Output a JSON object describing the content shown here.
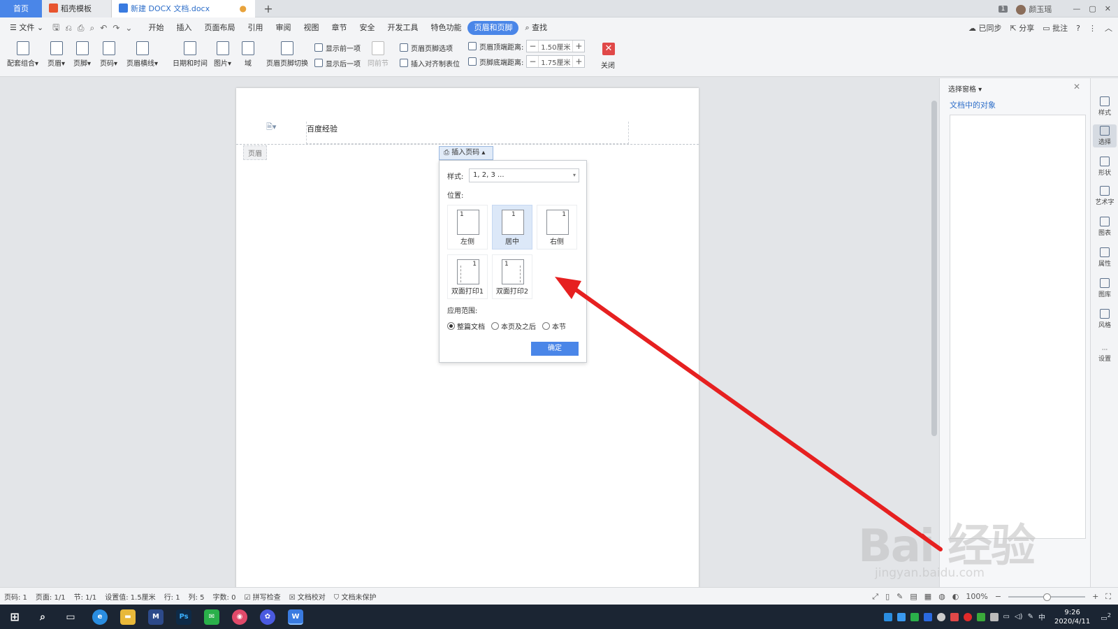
{
  "tabs": {
    "home": "首页",
    "template": "稻壳模板",
    "document": "新建 DOCX 文档.docx",
    "modified_dot": "●",
    "new_tab": "+"
  },
  "titlebar": {
    "badge": "1",
    "user": "颜玉瑶",
    "minimize": "—",
    "restore": "▢",
    "close": "✕"
  },
  "menu": {
    "file": "文件",
    "items": [
      "开始",
      "插入",
      "页面布局",
      "引用",
      "审阅",
      "视图",
      "章节",
      "安全",
      "开发工具",
      "特色功能",
      "页眉和页脚"
    ],
    "search": "查找",
    "sync": "已同步",
    "share": "分享",
    "comment": "批注",
    "help": "?"
  },
  "ribbon": {
    "combo": "配套组合",
    "header": "页眉",
    "footer": "页脚",
    "page_num": "页码",
    "header_line": "页眉横线",
    "datetime": "日期和时间",
    "picture": "图片",
    "field": "域",
    "switch": "页眉页脚切换",
    "show_prev": "显示前一项",
    "show_next": "显示后一项",
    "same_prev": "同前节",
    "hf_options": "页眉页脚选项",
    "insert_tab": "插入对齐制表位",
    "header_top": "页眉顶端距离:",
    "header_top_val": "1.50厘米",
    "footer_bottom": "页脚底端距离:",
    "footer_bottom_val": "1.75厘米",
    "minus": "−",
    "plus": "+",
    "close": "关闭"
  },
  "document": {
    "header_text": "百度经验",
    "header_tag": "页眉"
  },
  "insert_page_number": {
    "button": "插入页码",
    "style_label": "样式:",
    "style_value": "1, 2, 3 ...",
    "position_label": "位置:",
    "positions": {
      "left": "左侧",
      "center": "居中",
      "right": "右侧",
      "duplex1": "双面打印1",
      "duplex2": "双面打印2"
    },
    "page_digit": "1",
    "selected_position": "居中",
    "scope_label": "应用范围:",
    "scope_whole": "整篇文档",
    "scope_after": "本页及之后",
    "scope_section": "本节",
    "selected_scope": "整篇文档",
    "ok": "确定"
  },
  "panel": {
    "title": "选择窗格",
    "objects_link": "文档中的对象"
  },
  "sidebar": [
    "样式",
    "选择",
    "形状",
    "艺术字",
    "图表",
    "属性",
    "图库",
    "风格",
    "设置"
  ],
  "status": {
    "page_no": "页码: 1",
    "pages": "页面: 1/1",
    "section": "节: 1/1",
    "setting": "设置值: 1.5厘米",
    "row": "行: 1",
    "col": "列: 5",
    "words": "字数: 0",
    "spell": "拼写检查",
    "proof": "文档校对",
    "protect": "文档未保护",
    "zoom": "100%"
  },
  "taskbar": {
    "time": "9:26",
    "date": "2020/4/11",
    "ime": "中",
    "notif": "2"
  },
  "watermark": {
    "brand": "Bai 经验",
    "url": "jingyan.baidu.com"
  },
  "colors": {
    "accent": "#4a86e8",
    "arrow": "#e62020",
    "close_red": "#e04848"
  }
}
